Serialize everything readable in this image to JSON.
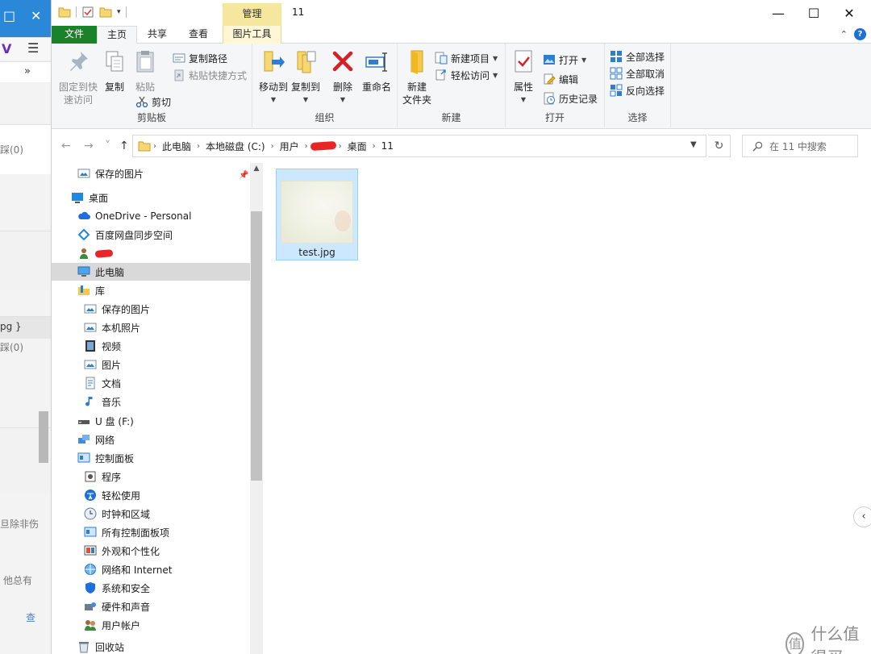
{
  "background_window": {
    "title_buttons": [
      "□",
      "✕"
    ],
    "toolbar_buttons": [
      "V",
      "☰",
      "»"
    ],
    "texts": [
      "踩(0)",
      "pg }",
      "踩(0)",
      "旦除非伤",
      "他总有",
      "查"
    ]
  },
  "window": {
    "title": "11",
    "manage_tab": "管理",
    "controls": {
      "minimize": "—",
      "maximize": "☐",
      "close": "✕"
    }
  },
  "tabs": [
    {
      "label": "文件"
    },
    {
      "label": "主页"
    },
    {
      "label": "共享"
    },
    {
      "label": "查看"
    },
    {
      "label": "图片工具"
    }
  ],
  "ribbon_right": {
    "expand": "⌃",
    "help": "?"
  },
  "ribbon": {
    "clipboard": {
      "label": "剪贴板",
      "pin_line1": "固定到快",
      "pin_line2": "速访问",
      "copy": "复制",
      "paste": "粘贴",
      "copy_path": "复制路径",
      "paste_shortcut": "粘贴快捷方式",
      "cut": "剪切"
    },
    "organize": {
      "label": "组织",
      "move_to": "移动到",
      "copy_to": "复制到",
      "delete": "删除",
      "rename": "重命名"
    },
    "new": {
      "label": "新建",
      "new_folder_line1": "新建",
      "new_folder_line2": "文件夹",
      "new_item": "新建项目",
      "easy_access": "轻松访问"
    },
    "open": {
      "label": "打开",
      "properties": "属性",
      "open": "打开",
      "edit": "编辑",
      "history": "历史记录"
    },
    "select": {
      "label": "选择",
      "select_all": "全部选择",
      "select_none": "全部取消",
      "invert": "反向选择"
    }
  },
  "address": {
    "back": "←",
    "forward": "→",
    "up": "↑",
    "crumbs": [
      "此电脑",
      "本地磁盘 (C:)",
      "用户",
      "桌面",
      "11"
    ],
    "refresh": "↻",
    "search_placeholder": "在 11 中搜索"
  },
  "nav": {
    "items": [
      {
        "label": "保存的图片",
        "icon": "saved-pictures-icon"
      },
      {
        "label": "桌面",
        "icon": "desktop-icon"
      },
      {
        "label": "OneDrive - Personal",
        "icon": "onedrive-icon"
      },
      {
        "label": "百度网盘同步空间",
        "icon": "baidu-netdisk-icon"
      },
      {
        "label": "",
        "icon": "user-folder-icon"
      },
      {
        "label": "此电脑",
        "icon": "this-pc-icon"
      },
      {
        "label": "库",
        "icon": "libraries-icon"
      },
      {
        "label": "保存的图片",
        "icon": "saved-pictures-icon"
      },
      {
        "label": "本机照片",
        "icon": "camera-roll-icon"
      },
      {
        "label": "视频",
        "icon": "videos-icon"
      },
      {
        "label": "图片",
        "icon": "pictures-icon"
      },
      {
        "label": "文档",
        "icon": "documents-icon"
      },
      {
        "label": "音乐",
        "icon": "music-icon"
      },
      {
        "label": "U 盘 (F:)",
        "icon": "usb-drive-icon"
      },
      {
        "label": "网络",
        "icon": "network-icon"
      },
      {
        "label": "控制面板",
        "icon": "control-panel-icon"
      },
      {
        "label": "程序",
        "icon": "programs-icon"
      },
      {
        "label": "轻松使用",
        "icon": "ease-of-access-icon"
      },
      {
        "label": "时钟和区域",
        "icon": "clock-region-icon"
      },
      {
        "label": "所有控制面板项",
        "icon": "all-control-panel-icon"
      },
      {
        "label": "外观和个性化",
        "icon": "appearance-icon"
      },
      {
        "label": "网络和 Internet",
        "icon": "network-internet-icon"
      },
      {
        "label": "系统和安全",
        "icon": "system-security-icon"
      },
      {
        "label": "硬件和声音",
        "icon": "hardware-sound-icon"
      },
      {
        "label": "用户帐户",
        "icon": "user-accounts-icon"
      },
      {
        "label": "回收站",
        "icon": "recycle-bin-icon"
      }
    ]
  },
  "files": [
    {
      "name": "test.jpg"
    }
  ],
  "side_arrow": "‹",
  "watermark": {
    "logo": "值",
    "text": "什么值得买"
  },
  "colors": {
    "file_tab": "#19822b",
    "manage_tab": "#f5e79e",
    "selection": "#cce8ff",
    "nav_selected": "#d9d9d9"
  }
}
